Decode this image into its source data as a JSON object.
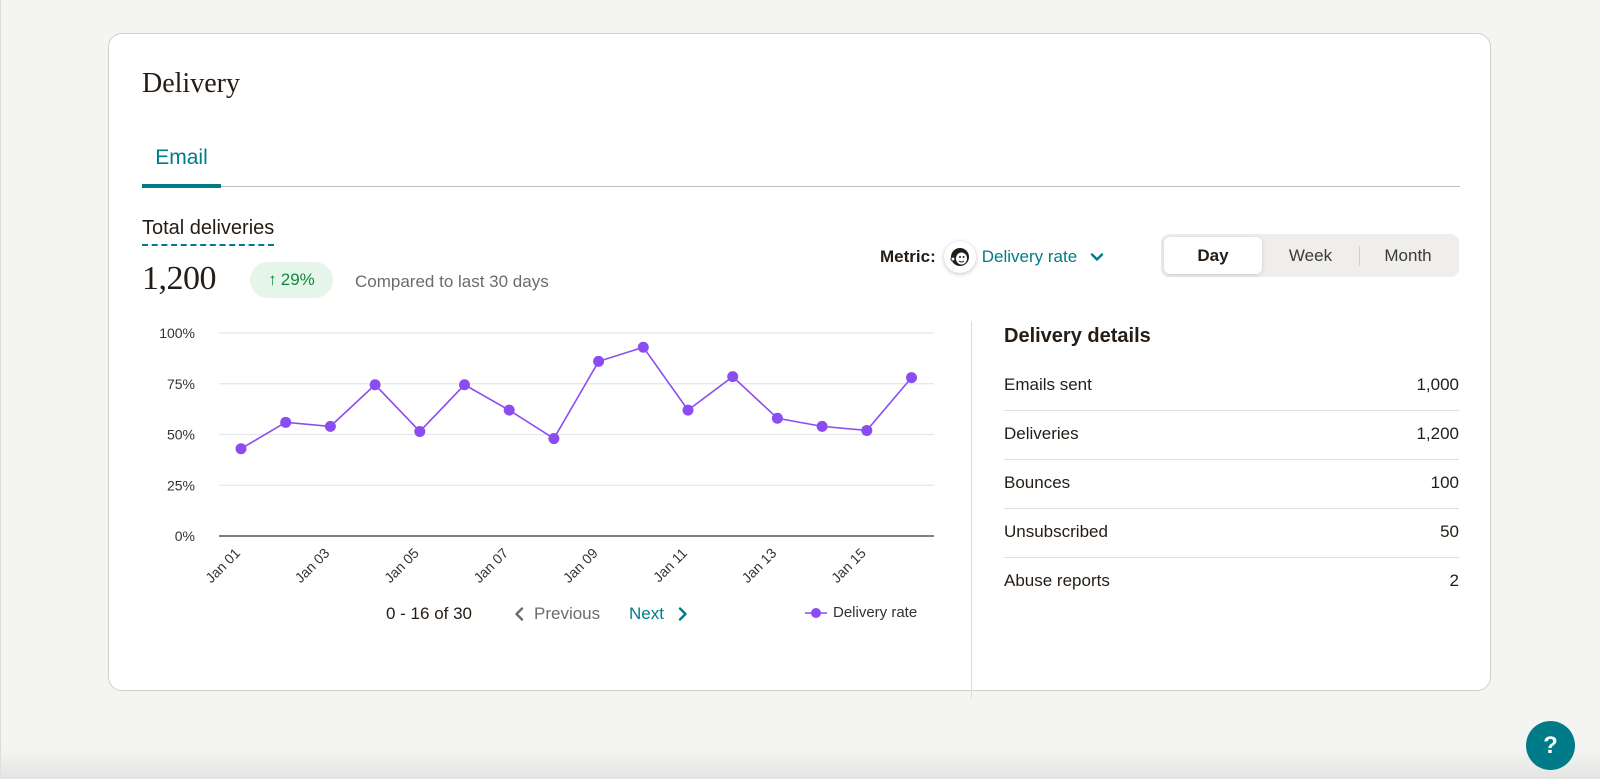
{
  "card": {
    "title": "Delivery",
    "tabs": [
      {
        "label": "Email",
        "active": true
      }
    ]
  },
  "summary": {
    "label": "Total deliveries",
    "value": "1,200",
    "change": "29%",
    "change_direction": "up",
    "compare_text": "Compared to last 30 days"
  },
  "metric": {
    "label": "Metric:",
    "selected": "Delivery rate",
    "icon": "mailchimp-freddie-icon"
  },
  "period": {
    "options": [
      "Day",
      "Week",
      "Month"
    ],
    "selected": "Day"
  },
  "pagination": {
    "range": "0 - 16 of 30",
    "previous_label": "Previous",
    "next_label": "Next"
  },
  "details": {
    "title": "Delivery details",
    "rows": [
      {
        "label": "Emails sent",
        "value": "1,000"
      },
      {
        "label": "Deliveries",
        "value": "1,200"
      },
      {
        "label": "Bounces",
        "value": "100"
      },
      {
        "label": "Unsubscribed",
        "value": "50"
      },
      {
        "label": "Abuse reports",
        "value": "2"
      }
    ]
  },
  "help": {
    "label": "?"
  },
  "colors": {
    "accent": "#007c89",
    "series": "#8b4df2",
    "positive": "#108a3a",
    "positive_bg": "#e6f5ea"
  },
  "chart_data": {
    "type": "line",
    "title": "",
    "xlabel": "",
    "ylabel": "",
    "x": [
      "Jan 01",
      "Jan 02",
      "Jan 03",
      "Jan 04",
      "Jan 05",
      "Jan 06",
      "Jan 07",
      "Jan 08",
      "Jan 09",
      "Jan 10",
      "Jan 11",
      "Jan 12",
      "Jan 13",
      "Jan 14",
      "Jan 15",
      "Jan 16"
    ],
    "x_tick_labels": [
      "Jan 01",
      "Jan 03",
      "Jan 05",
      "Jan 07",
      "Jan 09",
      "Jan 11",
      "Jan 13",
      "Jan 15"
    ],
    "y_ticks": [
      0,
      25,
      50,
      75,
      100
    ],
    "y_tick_labels": [
      "0%",
      "25%",
      "50%",
      "75%",
      "100%"
    ],
    "ylim": [
      0,
      100
    ],
    "grid": true,
    "legend": "bottom-right",
    "series": [
      {
        "name": "Delivery rate",
        "values": [
          43,
          56,
          54,
          74.5,
          51.5,
          74.5,
          62,
          48,
          86,
          93,
          62,
          78.5,
          58,
          54,
          52,
          78
        ]
      }
    ]
  }
}
